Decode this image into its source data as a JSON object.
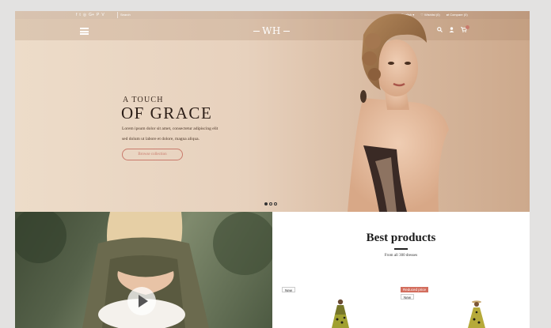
{
  "topbar": {
    "social_icons": [
      "facebook-icon",
      "twitter-icon",
      "instagram-icon",
      "google-plus-icon",
      "pinterest-icon",
      "vimeo-icon"
    ],
    "social_glyphs": [
      "f",
      "t",
      "◎",
      "G+",
      "P",
      "V"
    ],
    "search_label": "Search",
    "language": "English ▾",
    "wishlist": "♡ Wishlist (0)",
    "compare": "⇄ Compare (0)"
  },
  "navbar": {
    "logo": "WH",
    "icons": [
      "search-icon",
      "user-icon",
      "cart-icon"
    ]
  },
  "hero": {
    "subtitle": "A TOUCH",
    "title": "OF GRACE",
    "text_line1": "Lorem ipsum dolor sit amet, consectetur adipiscing elit",
    "text_line2": "sed dolum ut labore et dolore, magna aliqua.",
    "button": "Browse collection",
    "slides": 3,
    "active_slide": 1
  },
  "products": {
    "title": "Best products",
    "subtitle": "From all 300 dresses",
    "items": [
      {
        "tags": [
          "New"
        ]
      },
      {
        "tags": [
          "Reduced price",
          "New"
        ]
      }
    ]
  },
  "colors": {
    "accent": "#c97a6c",
    "hero_bg": "#e7d1bd"
  }
}
